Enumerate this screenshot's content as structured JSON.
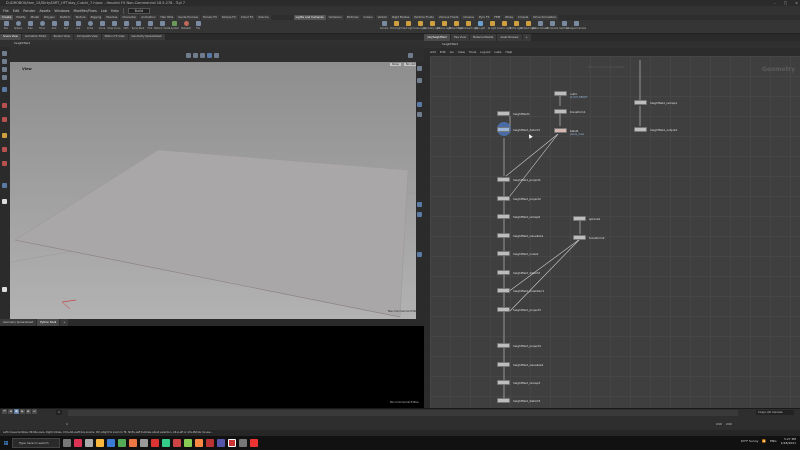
{
  "window": {
    "title": "D:/DROBOX/fam_15/Dirty/DIRT_HFT/day_Cutchi_7.hipnc - Houdini FX Non-Commercial 18.5.278 - Tuji 7"
  },
  "menubar": {
    "items": [
      "File",
      "Edit",
      "Render",
      "Assets",
      "Windows",
      "Modifier/Fixes",
      "Lab",
      "Help"
    ],
    "desktop": "Build",
    "shelves": [
      "Create",
      "Modify",
      "Model",
      "Polygon",
      "Deform",
      "Texture",
      "Rigging",
      "Muscles",
      "Character",
      "Animation",
      "Hair Utils",
      "Guide Process",
      "Terrain FX",
      "Simple FX",
      "Cloud FX",
      "Volume"
    ],
    "right_shelves": [
      "Lights and Cameras",
      "Collisions",
      "Particles",
      "Grains",
      "Vellum",
      "Rigid Bodies",
      "Particle Fluids",
      "Viscous Fluids",
      "Oceans",
      "Pyro FX",
      "FEM",
      "Wires",
      "Crowds",
      "Drive Simulation"
    ]
  },
  "shelf_tools": [
    "Box",
    "Sphere",
    "Tube",
    "Torus",
    "Grid",
    "Null",
    "Line",
    "Circle",
    "Curve",
    "Draw Curve",
    "Path",
    "Spray Paint",
    "Font",
    "Platonic Solids",
    "L-System",
    "Metaball",
    "File"
  ],
  "shelf_tools_right": [
    "Camera",
    "Point Light",
    "Spot Light",
    "Area Light",
    "Geometry Light",
    "Volume Light",
    "Distant Light",
    "Environment Light",
    "Sky Light",
    "GI Light",
    "Caustic Light",
    "Portal Light",
    "Ambient Light",
    "Stereo Camera",
    "VR Camera",
    "Switcher",
    "Gamepad Camera"
  ],
  "left_pane": {
    "tabs": [
      "Scene View",
      "Animation Editor",
      "Render View",
      "Composite View",
      "Motion FX View",
      "Geometry Spreadsheet"
    ],
    "path": "heightfield",
    "viewport_label": "View",
    "persp": "Persp",
    "cam": "No cam",
    "stats": "Non-Commercial Edition"
  },
  "bottom_left": {
    "tabs": [
      "Geometry Spreadsheet",
      "Python Shell"
    ],
    "status": "Non-Commercial Edition"
  },
  "network": {
    "tabs": [
      "/obj/heightfield",
      "Tree View",
      "Material Palette",
      "Asset Browser"
    ],
    "path": "heightfield",
    "menu": [
      "Add",
      "Edit",
      "Go",
      "View",
      "Tools",
      "Layout",
      "Labs",
      "Help"
    ],
    "watermark": "Geometry",
    "context": "Non-Commercial Edition",
    "nodes": [
      {
        "name": "heightfield1",
        "sub": "",
        "color": "grey"
      },
      {
        "name": "heightfield_distort1",
        "sub": "",
        "color": "blue"
      },
      {
        "name": "null1",
        "sub": "pt_OUT_HEIGHT",
        "color": "grey"
      },
      {
        "name": "transform1",
        "sub": "",
        "color": "grey"
      },
      {
        "name": "blast1",
        "sub": "pieces_noise",
        "color": "pink"
      },
      {
        "name": "heightfield_remap1",
        "sub": "",
        "color": "grey"
      },
      {
        "name": "heightfield_output1",
        "sub": "",
        "color": "grey"
      },
      {
        "name": "heightfield_project1",
        "sub": "",
        "color": "grey"
      },
      {
        "name": "heightfield_project2",
        "sub": "",
        "color": "grey"
      },
      {
        "name": "heightfield_remap2",
        "sub": "",
        "color": "grey"
      },
      {
        "name": "heightfield_visualize1",
        "sub": "",
        "color": "grey"
      },
      {
        "name": "heightfield_noise1",
        "sub": "",
        "color": "grey"
      },
      {
        "name": "heightfield_distort2",
        "sub": "",
        "color": "grey"
      },
      {
        "name": "heightfield_maskblur1",
        "sub": "",
        "color": "grey"
      },
      {
        "name": "heightfield_project3",
        "sub": "",
        "color": "grey"
      },
      {
        "name": "sphere1",
        "sub": "",
        "color": "grey"
      },
      {
        "name": "transform2",
        "sub": "",
        "color": "grey"
      },
      {
        "name": "heightfield_project4",
        "sub": "",
        "color": "grey"
      },
      {
        "name": "heightfield_visualize2",
        "sub": "",
        "color": "grey"
      },
      {
        "name": "heightfield_remap3",
        "sub": "",
        "color": "grey"
      },
      {
        "name": "heightfield_distort3",
        "sub": "",
        "color": "grey"
      }
    ]
  },
  "timeline": {
    "frame": "1",
    "start": "1",
    "end": "240",
    "end2": "240",
    "keys": "0 keys, 0/0 channels"
  },
  "status_line": "Left mouse tumbles, Middle pans, Right dollies. Ctrl+Alt+Left box-zooms. Ctrl+Right to zoom to fit. Shift+Left tumbles about selection. Alt+Left or Alt+Middle mouse...",
  "taskbar": {
    "search_placeholder": "Type here to search",
    "weather": "63°F Sunny",
    "time": "3:27 PM",
    "date": "1/28/2021",
    "lang": "ENG"
  },
  "colors": {
    "accent": "#587aa5",
    "node_pink": "#d7b7b2",
    "node_blue": "#9bb5d8"
  }
}
